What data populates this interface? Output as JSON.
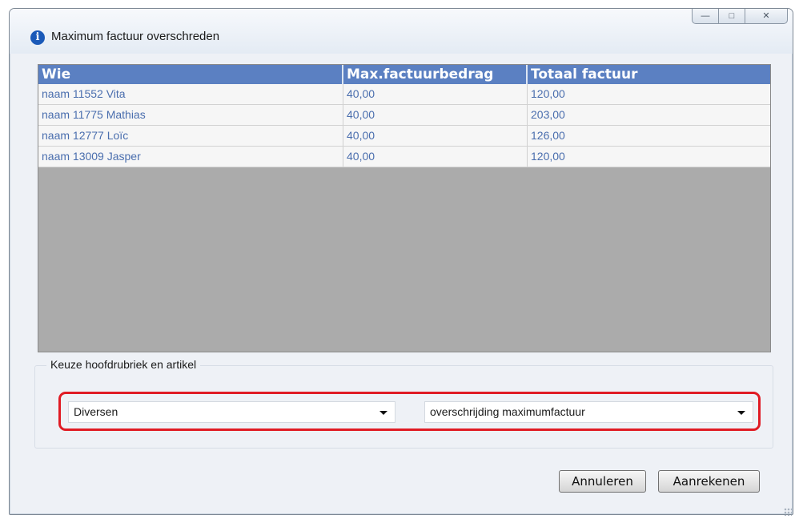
{
  "window": {
    "title": "Maximum factuur overschreden",
    "controls": {
      "minimize": "—",
      "maximize": "□",
      "close": "✕"
    }
  },
  "grid": {
    "columns": [
      "Wie",
      "Max.factuurbedrag",
      "Totaal factuur"
    ],
    "rows": [
      [
        "naam 11552 Vita",
        "40,00",
        "120,00"
      ],
      [
        "naam 11775 Mathias",
        "40,00",
        "203,00"
      ],
      [
        "naam 12777 Loïc",
        "40,00",
        "126,00"
      ],
      [
        "naam 13009 Jasper",
        "40,00",
        "120,00"
      ]
    ]
  },
  "selection": {
    "group_label": "Keuze hoofdrubriek en artikel",
    "hoofdrubriek": "Diversen",
    "artikel": "overschrijding maximumfactuur"
  },
  "buttons": {
    "cancel": "Annuleren",
    "charge": "Aanrekenen"
  },
  "colors": {
    "header_blue": "#5b80c2",
    "row_text": "#4a6eae",
    "highlight_red": "#e01b24"
  }
}
